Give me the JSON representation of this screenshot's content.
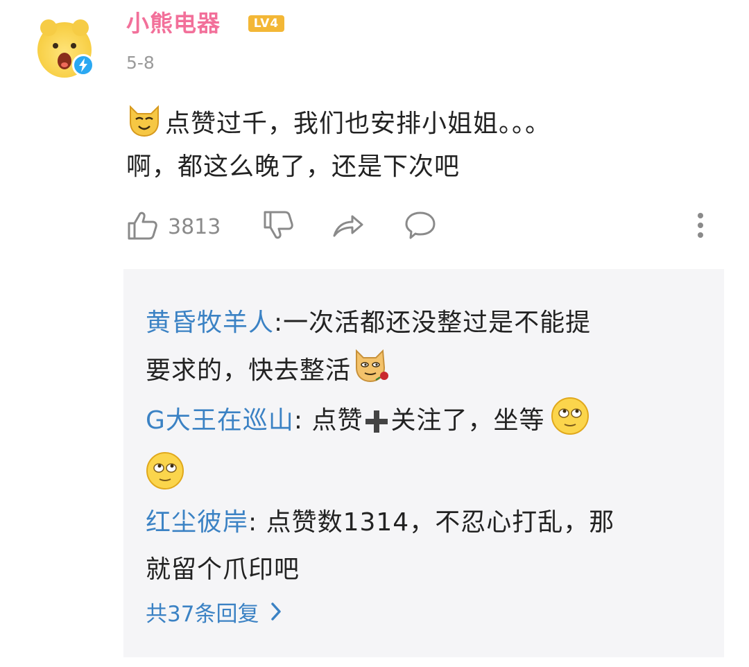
{
  "comment": {
    "username": "小熊电器",
    "level": "LV4",
    "date": "5-8",
    "text_line1": "点赞过千，我们也安排小姐姐。。。",
    "text_line2": "啊，都这么晚了，还是下次吧",
    "likes": "3813"
  },
  "replies": [
    {
      "author": "黄昏牧羊人",
      "line1": ":一次活都还没整过是不能提",
      "line2": "要求的，快去整活"
    },
    {
      "author": "G大王在巡山",
      "line1": ": 点赞",
      "line1b": "关注了，坐等"
    },
    {
      "author": "红尘彼岸",
      "line1": ": 点赞数1314，不忍心打乱，那",
      "line2": "就留个爪印吧"
    }
  ],
  "more_replies": "共37条回复",
  "colors": {
    "username": "#f2709a",
    "level_badge": "#f3b736",
    "reply_author": "#3b82c4",
    "verify_badge": "#2aa8f2"
  },
  "icons": [
    "thumbs-up-icon",
    "thumbs-down-icon",
    "share-icon",
    "comment-icon",
    "more-vertical-icon",
    "chevron-right-icon",
    "plus-emoji-icon"
  ]
}
